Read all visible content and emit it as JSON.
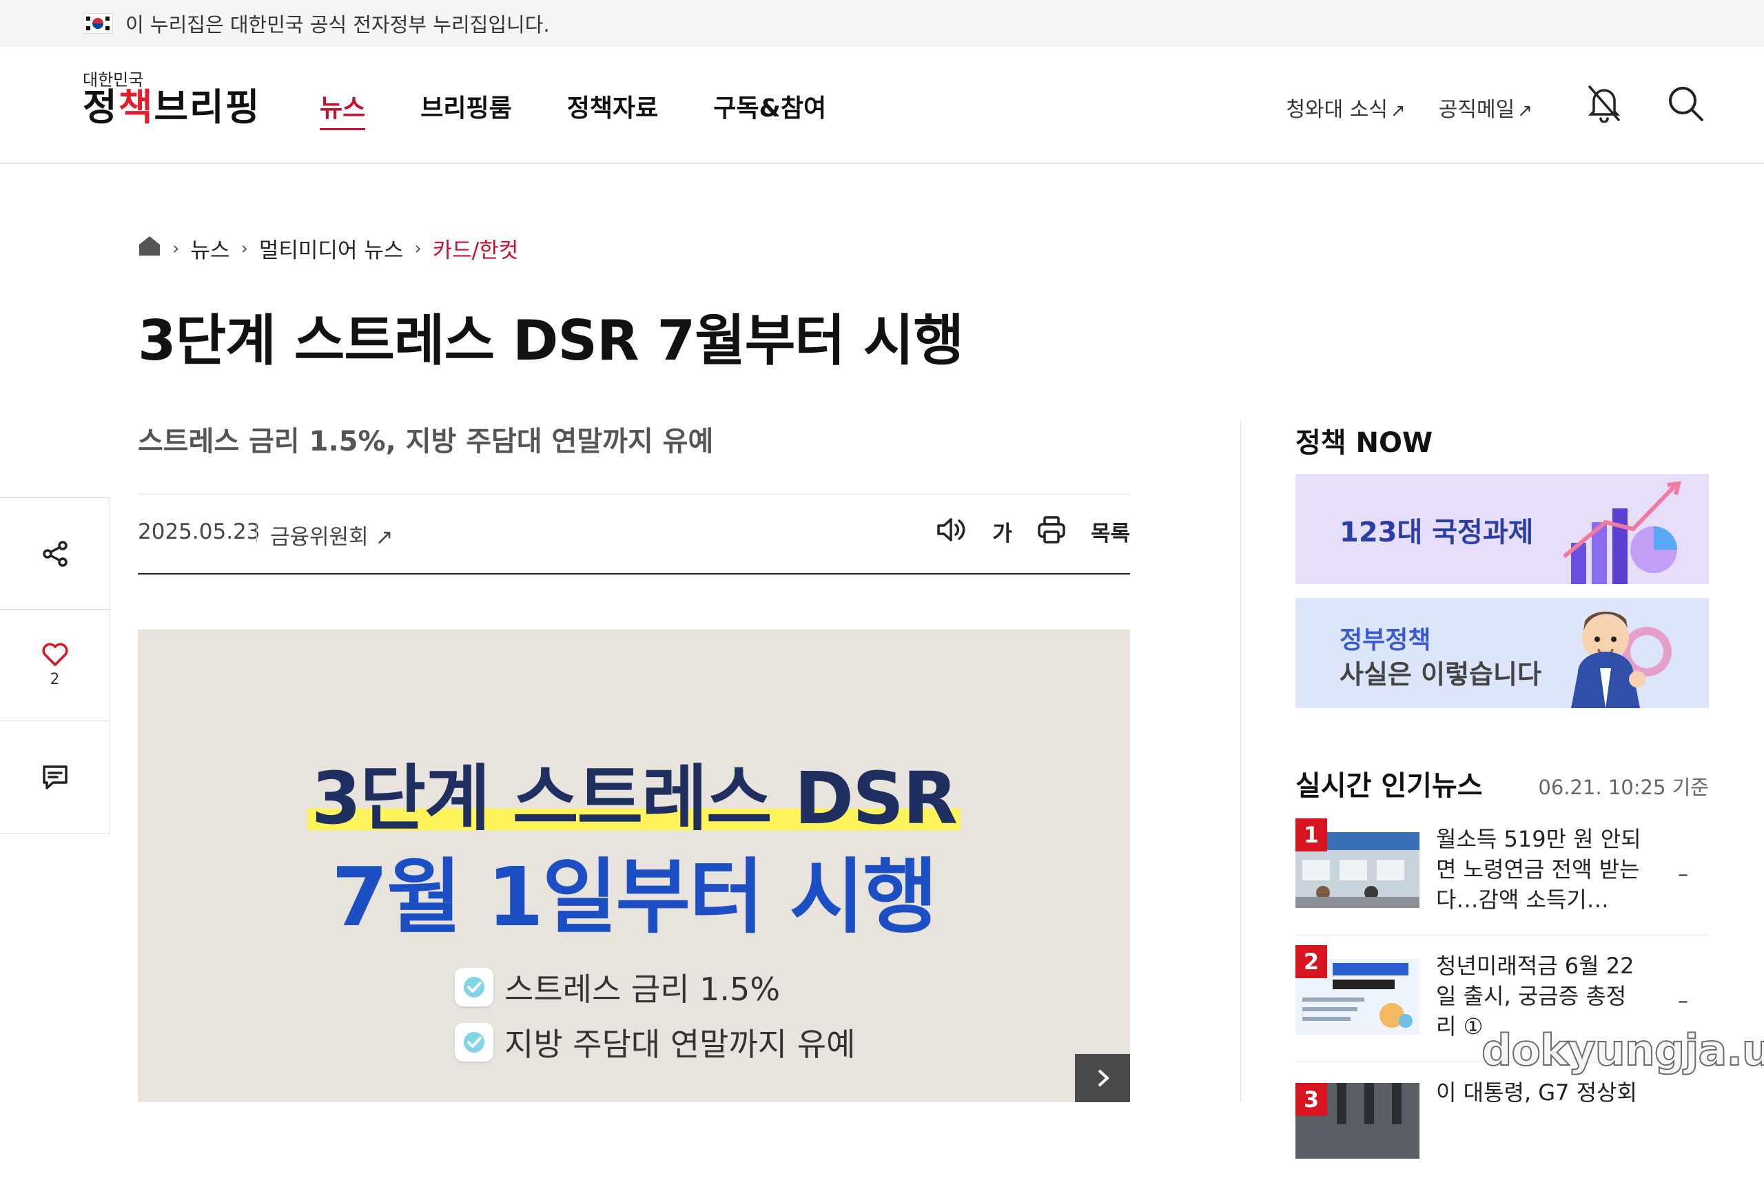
{
  "gov_bar": {
    "text": "이 누리집은 대한민국 공식 전자정부 누리집입니다."
  },
  "header": {
    "logo_small": "대한민국",
    "logo_main_a": "정",
    "logo_main_b": "책",
    "logo_main_c": "브리핑",
    "nav": [
      {
        "label": "뉴스",
        "active": true
      },
      {
        "label": "브리핑룸"
      },
      {
        "label": "정책자료"
      },
      {
        "label": "구독&참여"
      }
    ],
    "util_links": [
      {
        "label": "청와대 소식",
        "arrow": "↗"
      },
      {
        "label": "공직메일",
        "arrow": "↗"
      }
    ],
    "icons": [
      "bell-off-icon",
      "search-icon"
    ]
  },
  "breadcrumb": {
    "items": [
      "뉴스",
      "멀티미디어 뉴스"
    ],
    "current": "카드/한컷",
    "sep": "›"
  },
  "article": {
    "title": "3단계 스트레스 DSR 7월부터 시행",
    "subtitle": "스트레스 금리 1.5%, 지방 주담대 연말까지 유예",
    "date": "2025.05.23",
    "source": "금융위원회",
    "source_arrow": "↗",
    "tools": {
      "font_size_label": "가",
      "list_label": "목록"
    },
    "image": {
      "headline_1": "3단계 스트레스 DSR",
      "headline_2": "7월 1일부터 시행",
      "checks": [
        "스트레스 금리 1.5%",
        "지방 주담대 연말까지 유예"
      ]
    }
  },
  "sidebar": {
    "like_count": "2",
    "icons": [
      "share-icon",
      "heart-icon",
      "comment-icon"
    ]
  },
  "policy_now": {
    "title": "정책 NOW",
    "banners": [
      {
        "text": "123대 국정과제"
      },
      {
        "line1": "정부정책",
        "line2": "사실은 이렇습니다"
      }
    ]
  },
  "popular": {
    "title": "실시간 인기뉴스",
    "time": "06.21. 10:25 기준",
    "items": [
      {
        "rank": "1",
        "text": "월소득 519만 원 안되면 노령연금 전액 받는다…감액 소득기…",
        "dash": "–"
      },
      {
        "rank": "2",
        "text": "청년미래적금 6월 22일 출시, 궁금증 총정리 ①",
        "dash": "–"
      },
      {
        "rank": "3",
        "text": "이 대통령, G7 정상회",
        "dash": ""
      }
    ]
  },
  "watermark": "dokyungja.us",
  "colors": {
    "accent": "#c8102e",
    "rank_badge": "#d7141f",
    "banner1": "#e6defb",
    "banner2": "#dde5fb"
  }
}
